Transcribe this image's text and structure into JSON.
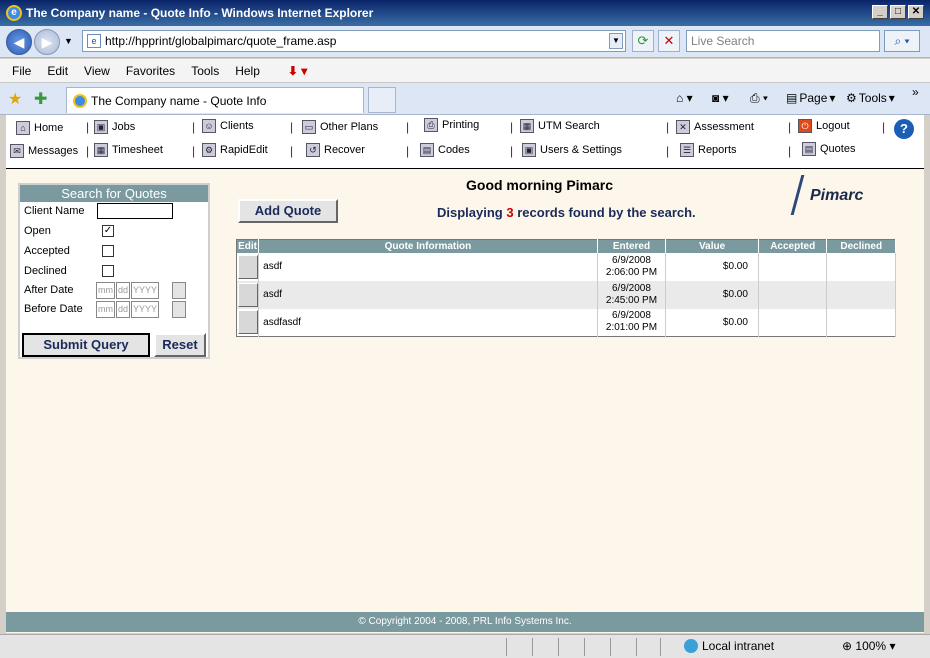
{
  "window": {
    "title": "The Company name - Quote Info - Windows Internet Explorer"
  },
  "browser": {
    "url": "http://hpprint/globalpimarc/quote_frame.asp",
    "search_placeholder": "Live Search",
    "menu": [
      "File",
      "Edit",
      "View",
      "Favorites",
      "Tools",
      "Help"
    ],
    "tab_title": "The Company name - Quote Info",
    "commands": {
      "page": "Page",
      "tools": "Tools"
    },
    "status": {
      "zone": "Local intranet",
      "zoom": "100%"
    }
  },
  "nav": {
    "row1": [
      "Home",
      "Jobs",
      "Clients",
      "Other Plans",
      "Printing",
      "UTM Search",
      "Assessment",
      "Logout"
    ],
    "row2": [
      "Messages",
      "Timesheet",
      "RapidEdit",
      "Recover",
      "Codes",
      "Users & Settings",
      "Reports",
      "Quotes"
    ]
  },
  "search_panel": {
    "title": "Search for Quotes",
    "client_name_label": "Client Name",
    "open_label": "Open",
    "accepted_label": "Accepted",
    "declined_label": "Declined",
    "after_date_label": "After Date",
    "before_date_label": "Before Date",
    "date_placeholders": {
      "mm": "mm",
      "dd": "dd",
      "yyyy": "YYYY"
    },
    "submit_label": "Submit Query",
    "reset_label": "Reset",
    "open_checked": true
  },
  "main": {
    "greeting": "Good morning Pimarc",
    "add_quote_label": "Add Quote",
    "display_prefix": "Displaying",
    "record_count": "3",
    "display_suffix": "records found by the search.",
    "logo_text": "Pimarc"
  },
  "table": {
    "headers": [
      "Edit",
      "Quote Information",
      "Entered",
      "Value",
      "Accepted",
      "Declined"
    ],
    "rows": [
      {
        "info": "asdf",
        "date": "6/9/2008",
        "time": "2:06:00 PM",
        "value": "$0.00"
      },
      {
        "info": "asdf",
        "date": "6/9/2008",
        "time": "2:45:00 PM",
        "value": "$0.00"
      },
      {
        "info": "asdfasdf",
        "date": "6/9/2008",
        "time": "2:01:00 PM",
        "value": "$0.00"
      }
    ]
  },
  "footer": {
    "copyright": "© Copyright 2004 - 2008, PRL Info Systems Inc."
  },
  "colors": {
    "header_teal": "#7a9aa0",
    "page_bg": "#fdf6ea",
    "count_red": "#cc0000"
  }
}
